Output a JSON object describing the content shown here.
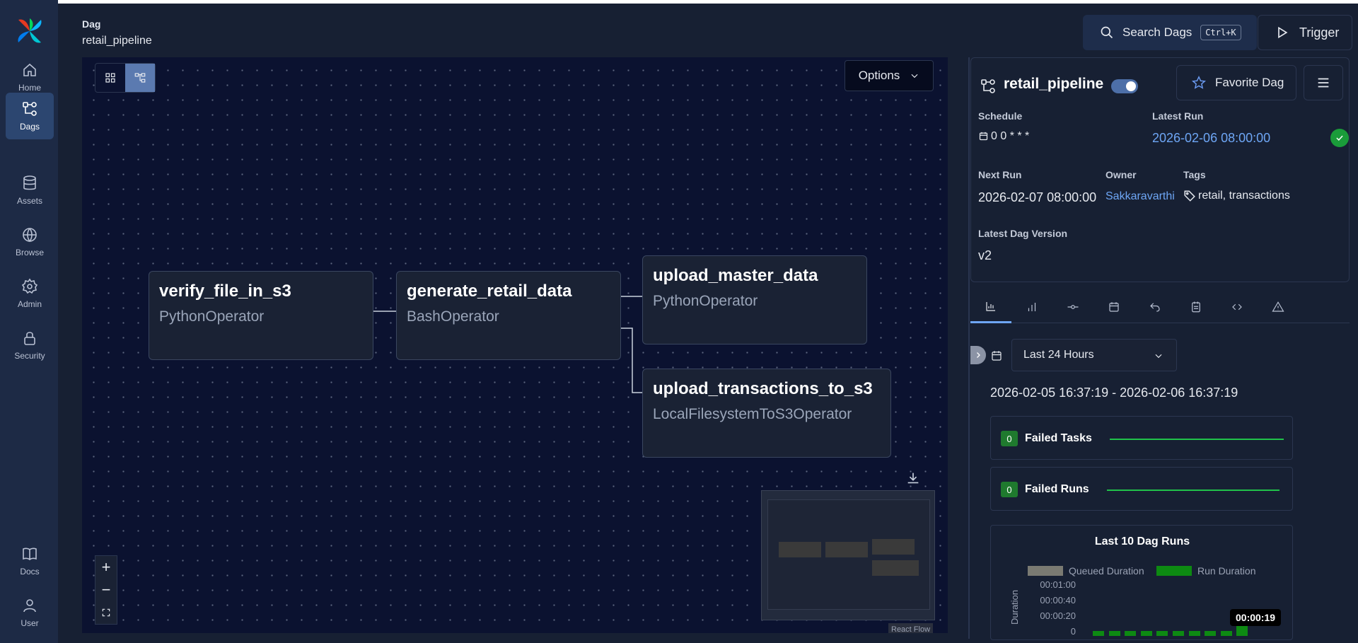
{
  "sidebar": {
    "items": [
      {
        "label": "Home"
      },
      {
        "label": "Dags"
      },
      {
        "label": "Assets"
      },
      {
        "label": "Browse"
      },
      {
        "label": "Admin"
      },
      {
        "label": "Security"
      },
      {
        "label": "Docs"
      },
      {
        "label": "User"
      }
    ],
    "active": "Dags"
  },
  "header": {
    "breadcrumb_label": "Dag",
    "title": "retail_pipeline",
    "search_label": "Search Dags",
    "search_shortcut": "Ctrl+K",
    "trigger_label": "Trigger"
  },
  "graph": {
    "view_modes": [
      "grid-icon",
      "graph-icon"
    ],
    "active_view": "graph",
    "options_label": "Options",
    "nodes": [
      {
        "name": "verify_file_in_s3",
        "operator": "PythonOperator"
      },
      {
        "name": "generate_retail_data",
        "operator": "BashOperator"
      },
      {
        "name": "upload_master_data",
        "operator": "PythonOperator"
      },
      {
        "name": "upload_transactions_to_s3",
        "operator": "LocalFilesystemToS3Operator"
      }
    ],
    "react_flow_label": "React Flow",
    "zoom_in": "+",
    "zoom_out": "−"
  },
  "detail": {
    "dag_name": "retail_pipeline",
    "paused": false,
    "favorite_label": "Favorite Dag",
    "schedule_label": "Schedule",
    "schedule_value": "0 0 * * *",
    "latest_run_label": "Latest Run",
    "latest_run_value": "2026-02-06 08:00:00",
    "next_run_label": "Next Run",
    "next_run_value": "2026-02-07 08:00:00",
    "owner_label": "Owner",
    "owner_value": "Sakkaravarthi",
    "tags_label": "Tags",
    "tags_value": "retail, transactions",
    "latest_version_label": "Latest Dag Version",
    "latest_version_value": "v2"
  },
  "tabs": [
    "overview-icon",
    "runs-icon",
    "tasks-icon",
    "calendar-icon",
    "backfills-icon",
    "events-icon",
    "code-icon",
    "warning-icon"
  ],
  "overview": {
    "range_label": "Last 24 Hours",
    "range_text": "2026-02-05 16:37:19 - 2026-02-06 16:37:19",
    "failed_tasks_count": "0",
    "failed_tasks_label": "Failed Tasks",
    "failed_runs_count": "0",
    "failed_runs_label": "Failed Runs"
  },
  "chart_data": {
    "type": "bar",
    "title": "Last 10 Dag Runs",
    "ylabel": "Duration",
    "yticks": [
      "00:01:00",
      "00:00:40",
      "00:00:20",
      "0"
    ],
    "series": [
      {
        "name": "Queued Duration",
        "color": "#7a7a72",
        "values": [
          0,
          0,
          0,
          0,
          0,
          0,
          0,
          0,
          0,
          0
        ]
      },
      {
        "name": "Run Duration",
        "color": "#0d8a12",
        "values": [
          6,
          6,
          6,
          6,
          6,
          6,
          6,
          6,
          6,
          19
        ]
      }
    ],
    "y_unit": "seconds",
    "ylim": [
      0,
      60
    ],
    "tooltip": "00:00:19"
  }
}
